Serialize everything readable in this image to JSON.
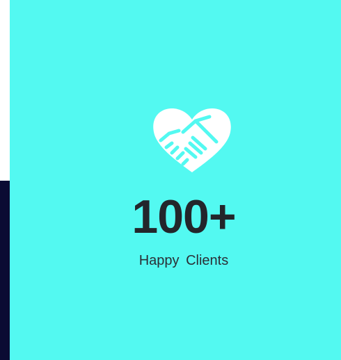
{
  "stat": {
    "icon": "heart-handshake-icon",
    "number": "100+",
    "label": "Happy  Clients"
  },
  "colors": {
    "card_background": "#53f9f1",
    "left_strip": "#0b0b33",
    "text": "#23262b",
    "icon": "#ffffff"
  }
}
